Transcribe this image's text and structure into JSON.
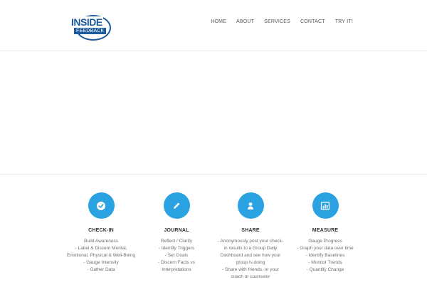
{
  "header": {
    "logo": {
      "top": "INSIDE",
      "bottom": "FEEDBACK"
    },
    "nav": [
      "HOME",
      "ABOUT",
      "SERVICES",
      "CONTACT",
      "TRY IT!"
    ]
  },
  "features": [
    {
      "icon": "check-icon",
      "title": "CHECK-IN",
      "lines": [
        "Build Awareness",
        "- Label & Discern Mental,",
        "Emotional, Physical & Well-Being",
        "- Gauge Intensity",
        "- Gather Data"
      ]
    },
    {
      "icon": "pencil-icon",
      "title": "JOURNAL",
      "lines": [
        "Reflect / Clarify",
        "- Identify Triggers",
        "- Set Goals",
        "- Discern Facts vs",
        "Interpretations"
      ]
    },
    {
      "icon": "user-icon",
      "title": "SHARE",
      "lines": [
        "- Anonymously post your check-",
        "in results to a Group Daily",
        "Dashboard and see how your",
        "group is doing",
        "- Share with friends, or your",
        "coach or counselor"
      ]
    },
    {
      "icon": "bar-chart-icon",
      "title": "MEASURE",
      "lines": [
        "Gauge Progress",
        "- Graph your data over time",
        "- Identify Baselines",
        "- Monitor Trends",
        "- Quantify Change"
      ]
    }
  ],
  "colors": {
    "accent": "#2aa2e1",
    "brand": "#1b5a9c"
  }
}
